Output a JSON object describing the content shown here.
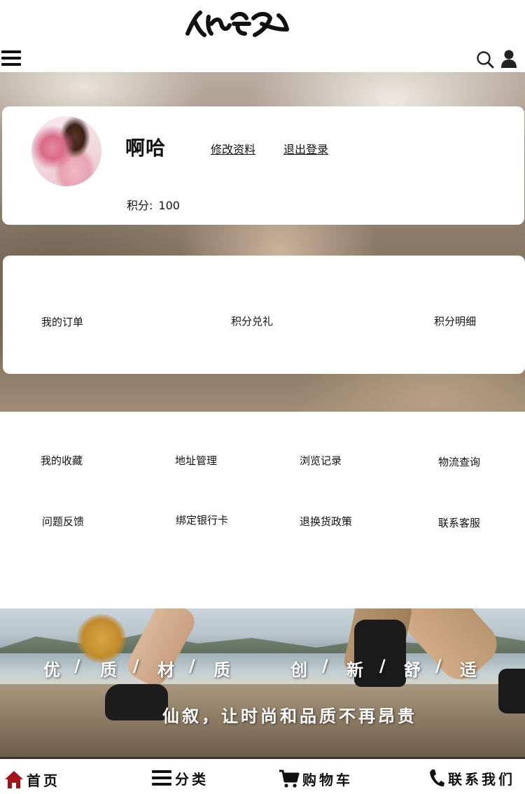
{
  "header": {
    "logo_text": "仙叙",
    "menu_icon": "hamburger-menu-icon",
    "search_icon": "search-icon",
    "user_icon": "user-icon"
  },
  "profile": {
    "username": "啊哈",
    "edit_label": "修改资料",
    "logout_label": "退出登录",
    "points_label": "积分:",
    "points_value": "100"
  },
  "orders": {
    "items": [
      {
        "label": "我的订单"
      },
      {
        "label": "积分兑礼"
      },
      {
        "label": "积分明细"
      }
    ]
  },
  "services": {
    "items": [
      {
        "label": "我的收藏"
      },
      {
        "label": "地址管理"
      },
      {
        "label": "浏览记录"
      },
      {
        "label": "物流查询"
      },
      {
        "label": "问题反馈"
      },
      {
        "label": "绑定银行卡"
      },
      {
        "label": "退换货政策"
      },
      {
        "label": "联系客服"
      }
    ]
  },
  "banner": {
    "slogan_chars": [
      "优",
      "/",
      "质",
      "/",
      "材",
      "/",
      "质",
      "创",
      "/",
      "新",
      "/",
      "舒",
      "/",
      "适"
    ],
    "tagline": "仙叙，让时尚和品质不再昂贵"
  },
  "tabbar": {
    "items": [
      {
        "label": "首页",
        "icon": "home-icon"
      },
      {
        "label": "分类",
        "icon": "menu-list-icon"
      },
      {
        "label": "购物车",
        "icon": "cart-icon"
      },
      {
        "label": "联系我们",
        "icon": "phone-icon"
      }
    ],
    "accent_color": "#a0141a"
  }
}
